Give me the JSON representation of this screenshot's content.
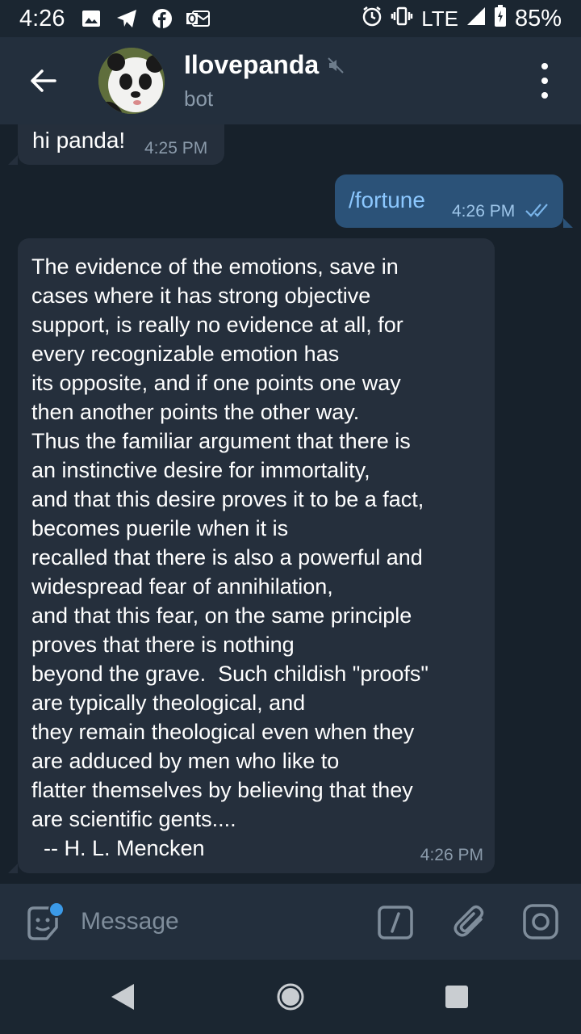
{
  "status_bar": {
    "time": "4:26",
    "network": "LTE",
    "battery": "85%",
    "icons": [
      "gallery-icon",
      "telegram-icon",
      "facebook-icon",
      "outlook-icon",
      "alarm-icon",
      "vibrate-icon",
      "signal-icon",
      "battery-icon"
    ]
  },
  "header": {
    "title": "Ilovepanda",
    "subtitle": "bot",
    "muted": true
  },
  "messages": [
    {
      "direction": "incoming",
      "text": "hi panda!",
      "time": "4:25 PM"
    },
    {
      "direction": "outgoing",
      "text": "/fortune",
      "time": "4:26 PM",
      "read": true
    },
    {
      "direction": "incoming",
      "text": "The evidence of the emotions, save in\ncases where it has strong objective\nsupport, is really no evidence at all, for\nevery recognizable emotion has\nits opposite, and if one points one way\nthen another points the other way.\nThus the familiar argument that there is\nan instinctive desire for immortality,\nand that this desire proves it to be a fact,\nbecomes puerile when it is\nrecalled that there is also a powerful and\nwidespread fear of annihilation,\nand that this fear, on the same principle\nproves that there is nothing\nbeyond the grave.  Such childish \"proofs\"\nare typically theological, and\nthey remain theological even when they\nare adduced by men who like to\nflatter themselves by believing that they\nare scientific gents....\n  -- H. L. Mencken",
      "time": "4:26 PM"
    }
  ],
  "composer": {
    "placeholder": "Message"
  },
  "colors": {
    "background": "#17212b",
    "header": "#232f3d",
    "incoming_bubble": "#252f3c",
    "outgoing_bubble": "#2b5278",
    "accent": "#3b9ae8",
    "command_text": "#8cc8ff"
  }
}
